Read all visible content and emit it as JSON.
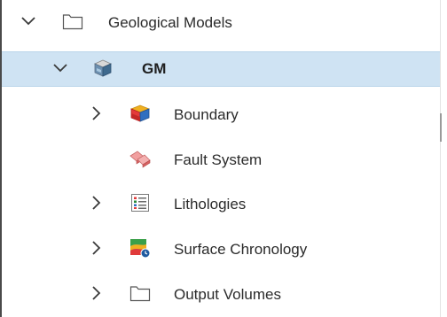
{
  "tree": {
    "items": [
      {
        "label": "Geological Models",
        "icon": "folder-icon",
        "expanded": true
      },
      {
        "label": "GM",
        "icon": "geological-model-icon",
        "expanded": true,
        "selected": true
      },
      {
        "label": "Boundary",
        "icon": "boundary-icon",
        "expanded": false
      },
      {
        "label": "Fault System",
        "icon": "fault-system-icon"
      },
      {
        "label": "Lithologies",
        "icon": "lithologies-list-icon",
        "expanded": false
      },
      {
        "label": "Surface Chronology",
        "icon": "surface-chronology-icon",
        "expanded": false
      },
      {
        "label": "Output Volumes",
        "icon": "folder-icon",
        "expanded": false
      }
    ]
  },
  "colors": {
    "selection": "#cfe3f3",
    "text": "#2b2b2b",
    "caret": "#3a3a3a"
  }
}
